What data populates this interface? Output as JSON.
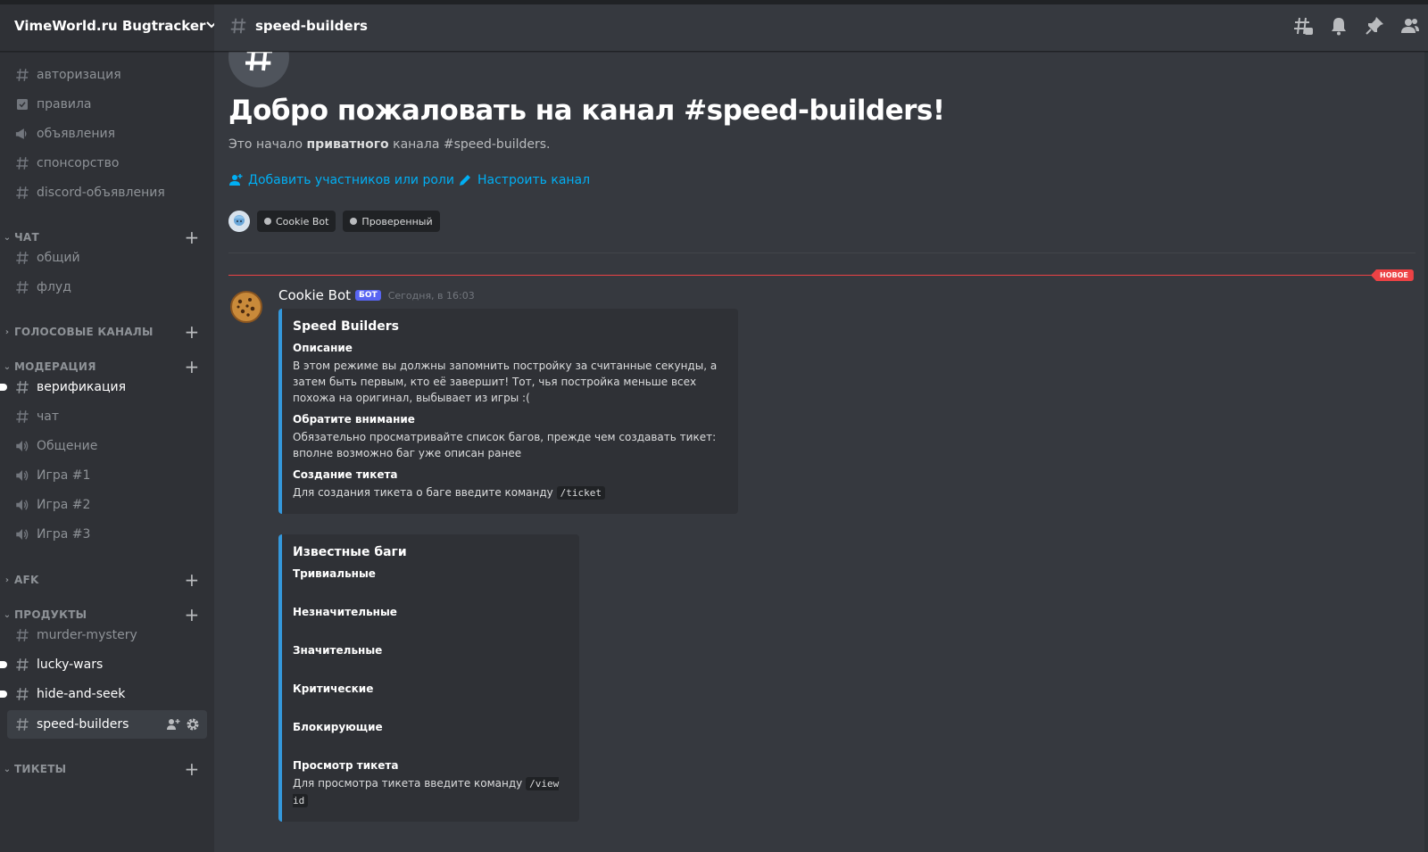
{
  "server": {
    "name": "VimeWorld.ru Bugtracker"
  },
  "channels_top": [
    {
      "label": "авторизация",
      "icon": "hash-icon"
    },
    {
      "label": "правила",
      "icon": "rules-checkbox-icon"
    },
    {
      "label": "объявления",
      "icon": "megaphone-icon"
    },
    {
      "label": "спонсорство",
      "icon": "hash-icon"
    },
    {
      "label": "discord-объявления",
      "icon": "hash-icon"
    }
  ],
  "categories": {
    "chat": {
      "label": "ЧАТ",
      "items": [
        "общий",
        "флуд"
      ]
    },
    "voice": {
      "label": "ГОЛОСОВЫЕ КАНАЛЫ"
    },
    "moderation": {
      "label": "МОДЕРАЦИЯ",
      "items": [
        {
          "label": "верификация",
          "icon": "hash-icon",
          "unread": true
        },
        {
          "label": "чат",
          "icon": "hash-icon"
        },
        {
          "label": "Общение",
          "icon": "speaker-icon"
        },
        {
          "label": "Игра #1",
          "icon": "speaker-icon"
        },
        {
          "label": "Игра #2",
          "icon": "speaker-icon"
        },
        {
          "label": "Игра #3",
          "icon": "speaker-icon"
        }
      ]
    },
    "afk": {
      "label": "AFK"
    },
    "products": {
      "label": "ПРОДУКТЫ",
      "items": [
        {
          "label": "murder-mystery",
          "unread": false
        },
        {
          "label": "lucky-wars",
          "unread": true
        },
        {
          "label": "hide-and-seek",
          "unread": true
        },
        {
          "label": "speed-builders",
          "active": true
        }
      ]
    },
    "tickets": {
      "label": "ТИКЕТЫ"
    }
  },
  "topbar": {
    "channel_name": "speed-builders"
  },
  "welcome": {
    "title": "Добро пожаловать на канал #speed-builders!",
    "sub_prefix": "Это начало ",
    "sub_bold": "приватного",
    "sub_suffix": " канала #speed-builders.",
    "add_members": "Добавить участников или роли",
    "configure": "Настроить канал",
    "roles": [
      "Cookie Bot",
      "Проверенный"
    ]
  },
  "new_badge": "НОВОЕ",
  "message": {
    "author": "Cookie Bot",
    "tag": "БОТ",
    "time": "Сегодня, в 16:03",
    "embed1": {
      "title": "Speed Builders",
      "fields": [
        {
          "name": "Описание",
          "value": "В этом режиме вы должны запомнить постройку за считанные секунды, а затем быть первым, кто её завершит! Тот, чья постройка меньше всех похожа на оригинал, выбывает из игры :("
        },
        {
          "name": "Обратите внимание",
          "value": "Обязательно просматривайте список багов, прежде чем создавать тикет: вполне возможно баг уже описан ранее"
        },
        {
          "name": "Создание тикета",
          "value": "Для создания тикета о баге введите команду ",
          "code": "/ticket"
        }
      ]
    },
    "embed2": {
      "title": "Известные баги",
      "fields": [
        {
          "name": "Тривиальные"
        },
        {
          "name": "Незначительные"
        },
        {
          "name": "Значительные"
        },
        {
          "name": "Критические"
        },
        {
          "name": "Блокирующие"
        },
        {
          "name": "Просмотр тикета",
          "value": "Для просмотра тикета введите команду ",
          "code": "/view id"
        }
      ]
    }
  },
  "colors": {
    "accent_link": "#00aff4",
    "new_divider": "#ed4245",
    "embed_border": "#3498db",
    "bot_tag": "#5865f2"
  }
}
